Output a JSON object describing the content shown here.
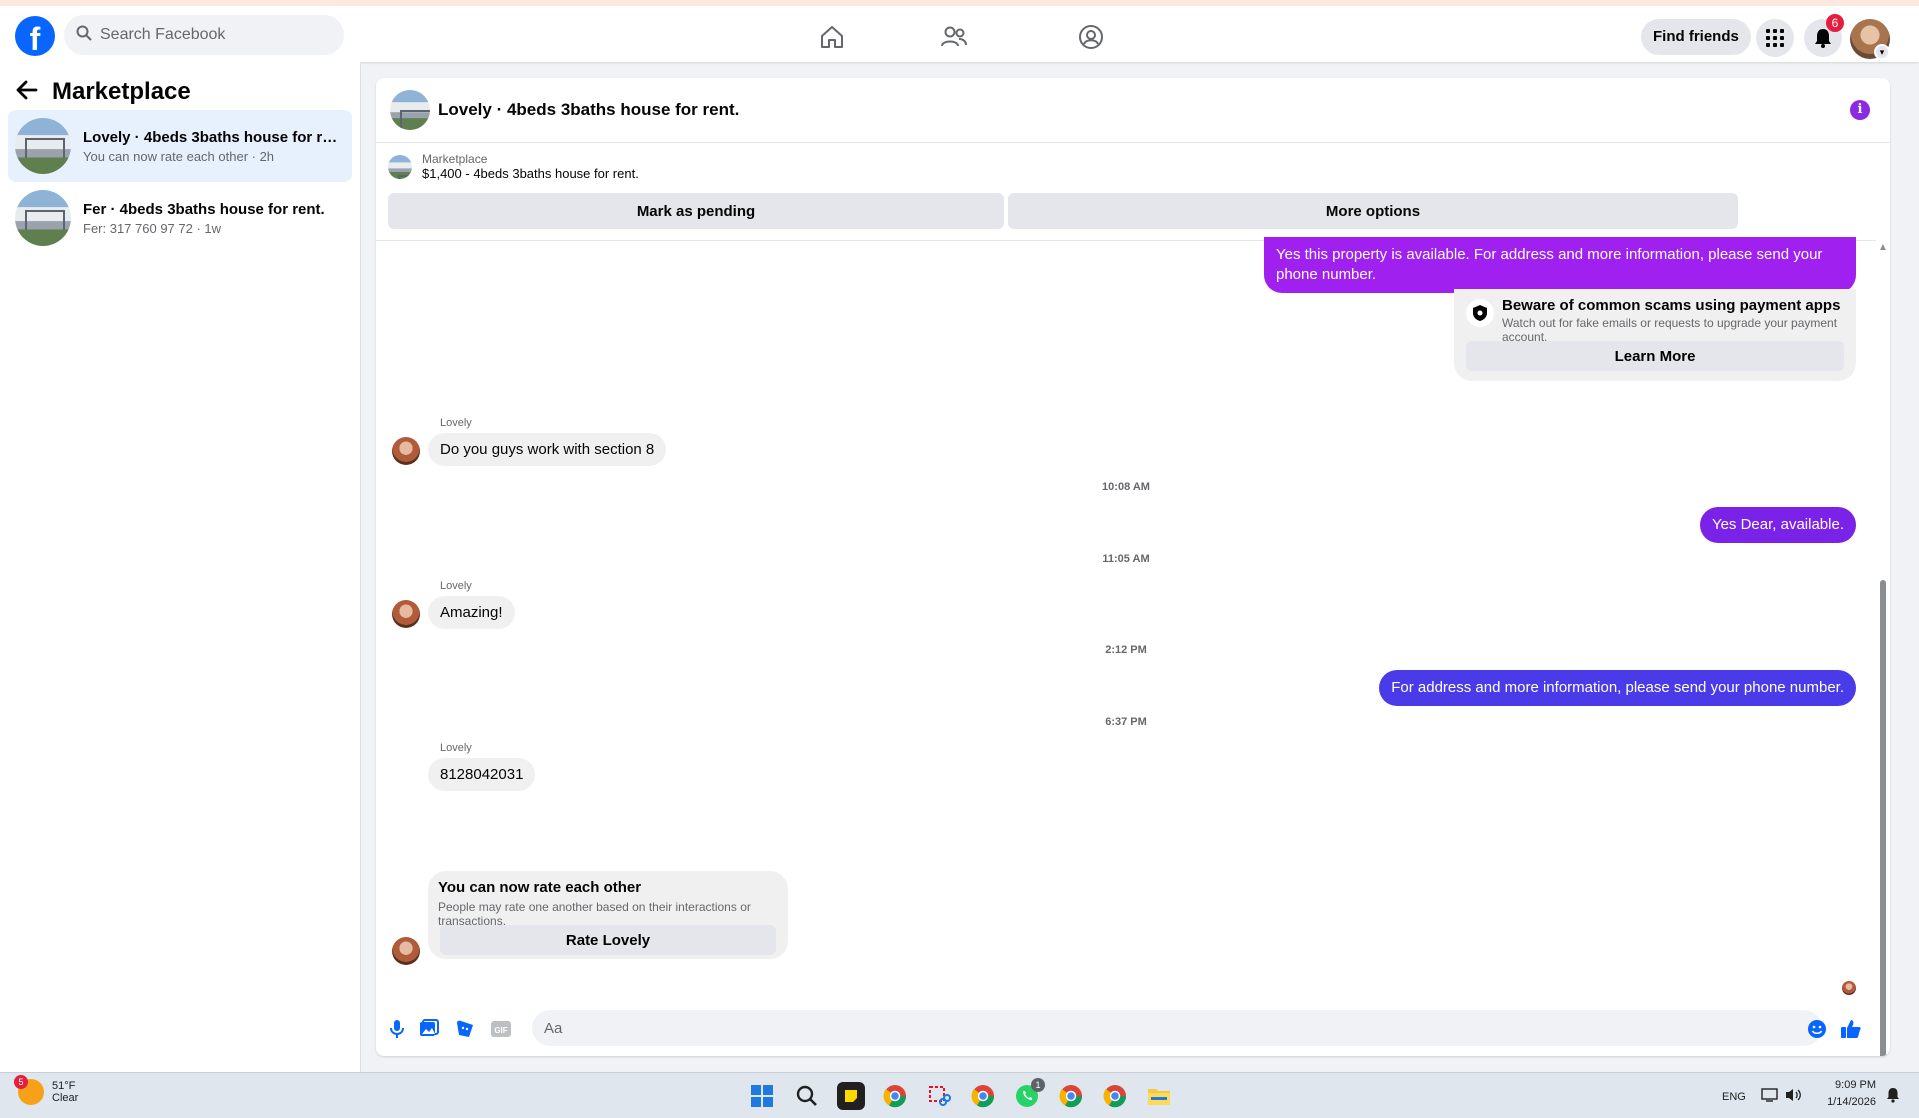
{
  "topbar": {
    "logo_letter": "f",
    "search_placeholder": "Search Facebook",
    "find_friends_label": "Find friends",
    "notification_count": "6"
  },
  "sidebar": {
    "title": "Marketplace",
    "conversations": [
      {
        "title": "Lovely · 4beds 3baths house for re...",
        "subtitle": "You can now rate each other · 2h"
      },
      {
        "title": "Fer · 4beds 3baths house for rent.",
        "subtitle": "Fer: 317 760 97 72 · 1w"
      }
    ]
  },
  "chat": {
    "title": "Lovely · 4beds 3baths house for rent.",
    "info_glyph": "i",
    "listing_source": "Marketplace",
    "listing_text": "$1,400 - 4beds 3baths house for rent.",
    "mark_pending_label": "Mark as pending",
    "more_options_label": "More options",
    "messages": {
      "out1": "Yes this property is available. For address and more information, please send your phone number.",
      "scam_title": "Beware of common scams using payment apps",
      "scam_sub": "Watch out for fake emails or requests to upgrade your payment account.",
      "learn_more_label": "Learn More",
      "sender_name": "Lovely",
      "in1": "Do you guys work with section 8",
      "time1": "10:08 AM",
      "out2": "Yes Dear, available.",
      "time2": "11:05 AM",
      "in2": "Amazing!",
      "time3": "2:12 PM",
      "out3": "For address and more information, please send your phone number.",
      "time4": "6:37 PM",
      "in3": "8128042031",
      "rate_title": "You can now rate each other",
      "rate_sub": "People may rate one another based on their interactions or transactions.",
      "rate_button": "Rate Lovely"
    },
    "composer_placeholder": "Aa",
    "gif_label": "GIF"
  },
  "taskbar": {
    "weather_badge": "5",
    "weather_temp": "51°F",
    "weather_cond": "Clear",
    "language": "ENG",
    "time": "9:09 PM",
    "date": "1/14/2026",
    "whatsapp_badge": "1"
  },
  "colors": {
    "fb_blue": "#0866ff",
    "outgoing_purple": "#a020f0",
    "outgoing_violet": "#7a22e8",
    "outgoing_blue": "#4a3be8",
    "notification_red": "#e41e3f"
  }
}
